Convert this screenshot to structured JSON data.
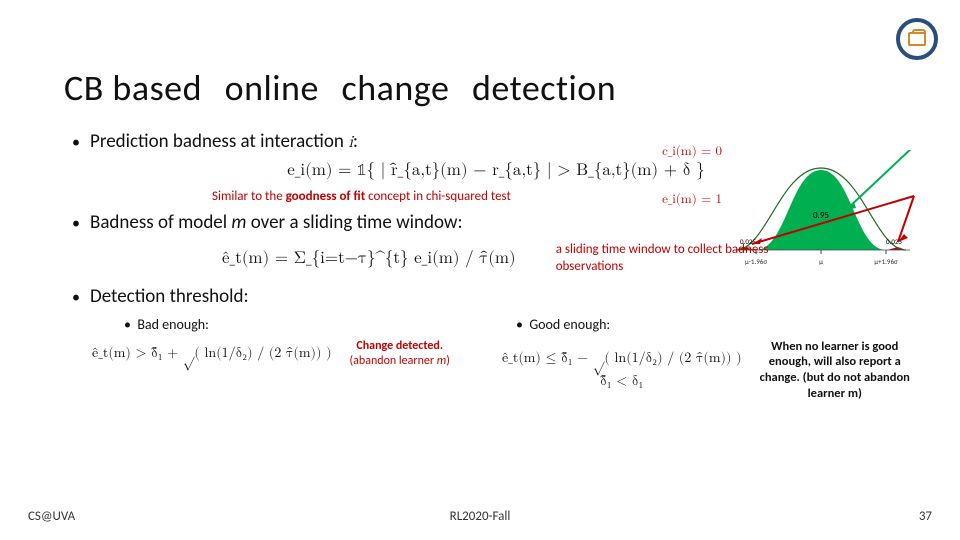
{
  "title": {
    "w1": "CB based",
    "w2": "online",
    "w3": "change",
    "w4": "detection"
  },
  "bullets": {
    "b1_prefix": "Prediction badness at interaction ",
    "b1_var": "i",
    "b1_suffix": ":",
    "eq1": "e_i(m) = 𝟙{ | r̂_{a,t}(m) − r_{a,t} | > B_{a,t}(m) + δ }",
    "note1a": "Similar  to  the  ",
    "note1b": "goodness of fit",
    "note1c": "  concept  in  chi-squared test",
    "b2_prefix": "Badness of model ",
    "b2_m": "m",
    "b2_suffix": " over a sliding time window:",
    "eq2": "ê_t(m)  =  Σ_{i=t−τ}^{t}  e_i(m)  /  τ̂(m)",
    "note2": "a  sliding time  window  to  collect badness  observations",
    "b3": "Detection threshold:",
    "sbad": "Bad  enough:",
    "sgood": "Good  enough:",
    "eq_bad": "ê_t(m) > δ̃₁ + √( ln(1/δ₂) / (2 τ̂(m)) )",
    "eq_good": "ê_t(m) ≤ δ̃₁ − √( ln(1/δ₂) / (2 τ̂(m)) )",
    "eq_good2": "δ̃₁ < δ₁",
    "note_bad1": "Change detected.",
    "note_bad2": "(abandon  learner ",
    "note_bad2m": "m",
    "note_bad2b": ")",
    "note_good": "When no learner is good enough, will also report a change. (but do not abandon learner m)",
    "bell_c0": "c_i(m) = 0",
    "bell_e1": "e_i(m) = 1",
    "bell_mid": "0.95",
    "bell_l": "0.025",
    "bell_r": "0.025",
    "bell_tx1": "μ-1.96σ",
    "bell_tx2": "μ",
    "bell_tx3": "μ+1.96σ"
  },
  "footer": {
    "left": "CS@UVA",
    "center": "RL2020-Fall",
    "right": "37"
  }
}
